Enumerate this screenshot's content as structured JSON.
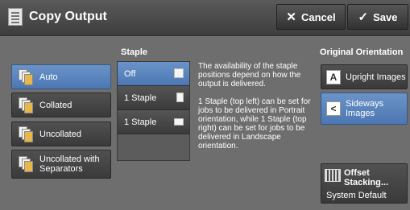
{
  "header": {
    "title": "Copy Output",
    "cancel_label": "Cancel",
    "save_label": "Save"
  },
  "output": {
    "items": [
      "Auto",
      "Collated",
      "Uncollated",
      "Uncollated with Separators"
    ],
    "selected": "Auto"
  },
  "staple": {
    "title": "Staple",
    "items": [
      "Off",
      "1 Staple",
      "1 Staple"
    ],
    "selected": "Off"
  },
  "info": {
    "paragraph1": "The availability of the staple positions depend on how the output is delivered.",
    "paragraph2": "1 Staple (top left) can be set for jobs to be delivered in Portrait orientation, while 1 Staple (top right) can be set for jobs to be delivered in Landscape orientation."
  },
  "orientation": {
    "title": "Original Orientation",
    "upright_label": "Upright Images",
    "sideways_label": "Sideways Images",
    "selected": "Sideways Images"
  },
  "offset": {
    "label": "Offset Stacking...",
    "value": "System Default"
  },
  "colors": {
    "selected": "#5b86c0",
    "button": "#454545",
    "background": "#6e6e6e"
  }
}
